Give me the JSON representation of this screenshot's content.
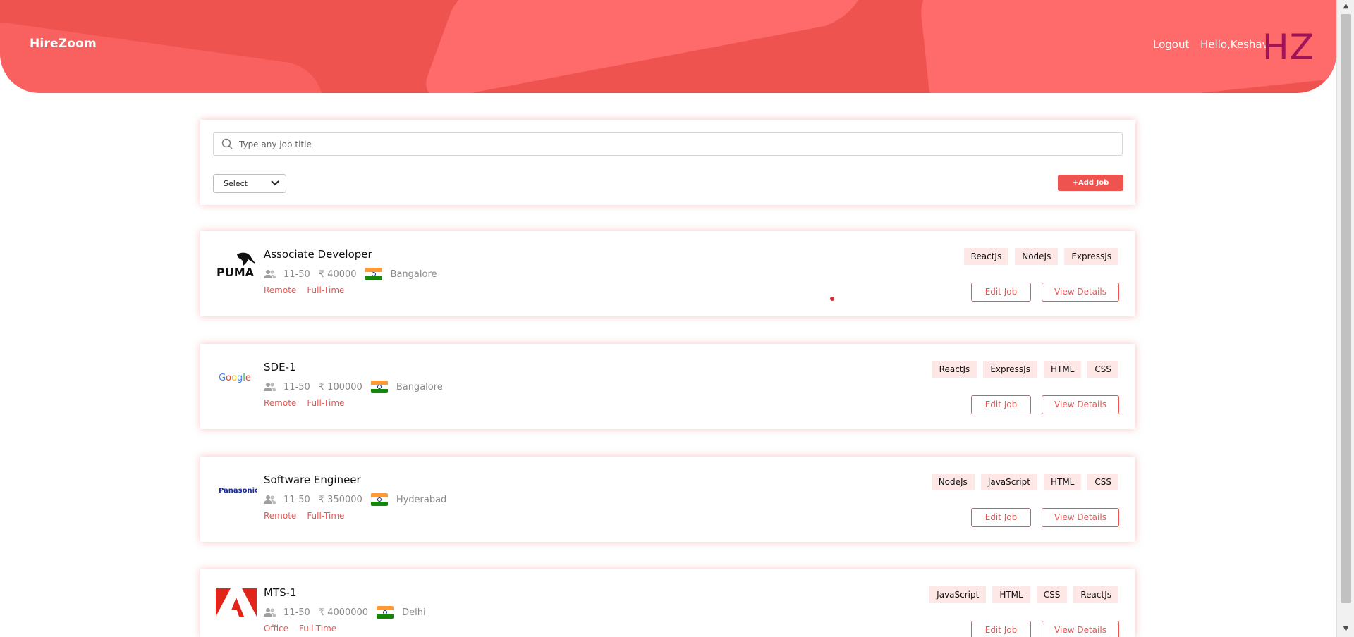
{
  "header": {
    "brand": "HireZoom",
    "logout_label": "Logout",
    "greeting": "Hello,Keshav",
    "logo_text": "HZ"
  },
  "search": {
    "placeholder": "Type any job title",
    "value": ""
  },
  "filter": {
    "selected": "Select"
  },
  "add_job_label": "+Add Job",
  "jobs": [
    {
      "company_logo": "puma-logo",
      "title": "Associate Developer",
      "team_size": "11-50",
      "salary": "₹ 40000",
      "country_flag": "india-flag",
      "location": "Bangalore",
      "mode": "Remote",
      "type": "Full-Time",
      "skills": [
        "ReactJs",
        "NodeJs",
        "ExpressJs"
      ],
      "edit_label": "Edit Job",
      "view_label": "View Details"
    },
    {
      "company_logo": "google-logo",
      "title": "SDE-1",
      "team_size": "11-50",
      "salary": "₹ 100000",
      "country_flag": "india-flag",
      "location": "Bangalore",
      "mode": "Remote",
      "type": "Full-Time",
      "skills": [
        "ReactJs",
        "ExpressJs",
        "HTML",
        "CSS"
      ],
      "edit_label": "Edit Job",
      "view_label": "View Details"
    },
    {
      "company_logo": "panasonic-logo",
      "title": "Software Engineer",
      "team_size": "11-50",
      "salary": "₹ 350000",
      "country_flag": "india-flag",
      "location": "Hyderabad",
      "mode": "Remote",
      "type": "Full-Time",
      "skills": [
        "NodeJs",
        "JavaScript",
        "HTML",
        "CSS"
      ],
      "edit_label": "Edit Job",
      "view_label": "View Details"
    },
    {
      "company_logo": "adobe-logo",
      "title": "MTS-1",
      "team_size": "11-50",
      "salary": "₹ 4000000",
      "country_flag": "india-flag",
      "location": "Delhi",
      "mode": "Office",
      "type": "Full-Time",
      "skills": [
        "JavaScript",
        "HTML",
        "CSS",
        "ReactJs"
      ],
      "edit_label": "Edit Job",
      "view_label": "View Details"
    }
  ],
  "colors": {
    "accent": "#ef5350",
    "accent_light": "#ff6b6b",
    "skill_bg": "#fde8e7",
    "logo_color": "#a01459"
  }
}
